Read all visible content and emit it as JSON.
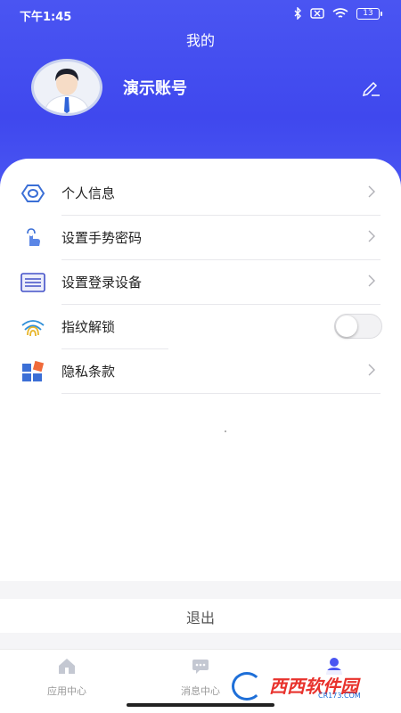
{
  "status_bar": {
    "time": "下午1:45",
    "battery": "13"
  },
  "header": {
    "title": "我的",
    "account_name": "演示账号"
  },
  "menu": [
    {
      "label": "个人信息",
      "icon": "eye-icon",
      "control": "chevron"
    },
    {
      "label": "设置手势密码",
      "icon": "hand-touch-icon",
      "control": "chevron"
    },
    {
      "label": "设置登录设备",
      "icon": "device-list-icon",
      "control": "chevron"
    },
    {
      "label": "指纹解锁",
      "icon": "fingerprint-icon",
      "control": "toggle",
      "toggle_on": false
    },
    {
      "label": "隐私条款",
      "icon": "blocks-icon",
      "control": "chevron"
    }
  ],
  "logout": {
    "label": "退出"
  },
  "tabbar": [
    {
      "label": "应用中心",
      "icon": "home-icon"
    },
    {
      "label": "消息中心",
      "icon": "message-icon"
    },
    {
      "label": "",
      "icon": "user-icon",
      "active": true
    }
  ],
  "watermark": {
    "text_cn": "西西软件园",
    "text_en": "CR173.COM"
  },
  "colors": {
    "accent": "#4a55f2",
    "header_bg": "#4351f0"
  }
}
